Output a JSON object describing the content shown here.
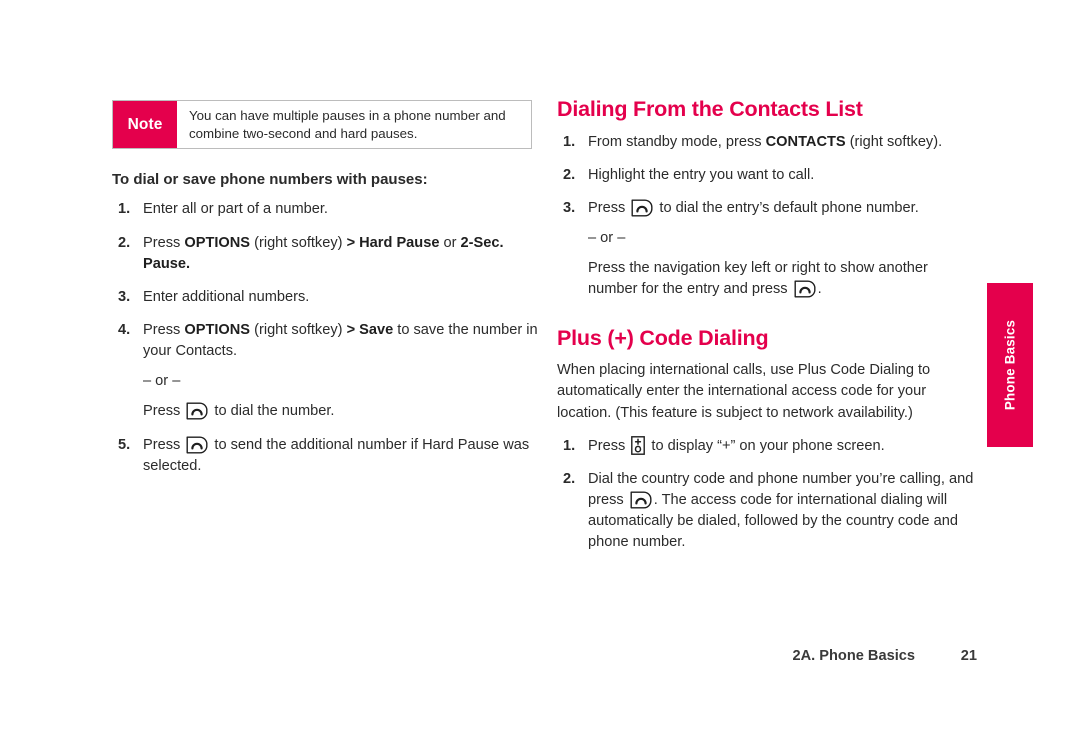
{
  "note": {
    "badge_label": "Note",
    "text": "You can have multiple pauses in a phone number and combine two-second and hard pauses.",
    "badge_color": "#e4004c",
    "border_color": "#bcbcbc"
  },
  "left_column": {
    "subheading": "To dial or save phone numbers with pauses:",
    "steps": [
      {
        "num": "1.",
        "parts": [
          {
            "type": "text",
            "value": "Enter all or part of a number."
          }
        ]
      },
      {
        "num": "2.",
        "parts": [
          {
            "type": "text",
            "value": "Press "
          },
          {
            "type": "bold",
            "value": "OPTIONS"
          },
          {
            "type": "text",
            "value": " (right softkey) "
          },
          {
            "type": "bold",
            "value": "> Hard Pause"
          },
          {
            "type": "text",
            "value": " or "
          },
          {
            "type": "bold",
            "value": "2-Sec. Pause."
          }
        ]
      },
      {
        "num": "3.",
        "parts": [
          {
            "type": "text",
            "value": "Enter additional numbers."
          }
        ]
      },
      {
        "num": "4.",
        "parts": [
          {
            "type": "text",
            "value": "Press "
          },
          {
            "type": "bold",
            "value": "OPTIONS"
          },
          {
            "type": "text",
            "value": " (right softkey) "
          },
          {
            "type": "bold",
            "value": "> Save"
          },
          {
            "type": "text",
            "value": " to save the number in your Contacts."
          }
        ],
        "sub_lines": [
          {
            "parts": [
              {
                "type": "text",
                "value": "– or –"
              }
            ]
          },
          {
            "parts": [
              {
                "type": "text",
                "value": "Press "
              },
              {
                "type": "icon",
                "value": "talk-key-icon"
              },
              {
                "type": "text",
                "value": " to dial the number."
              }
            ]
          }
        ]
      },
      {
        "num": "5.",
        "parts": [
          {
            "type": "text",
            "value": "Press "
          },
          {
            "type": "icon",
            "value": "talk-key-icon"
          },
          {
            "type": "text",
            "value": " to send the additional number if Hard Pause was selected."
          }
        ]
      }
    ]
  },
  "right_column": {
    "section_1": {
      "title": "Dialing From the Contacts List",
      "steps": [
        {
          "num": "1.",
          "parts": [
            {
              "type": "text",
              "value": "From standby mode, press "
            },
            {
              "type": "bold",
              "value": "CONTACTS"
            },
            {
              "type": "text",
              "value": " (right softkey)."
            }
          ]
        },
        {
          "num": "2.",
          "parts": [
            {
              "type": "text",
              "value": "Highlight the entry you want to call."
            }
          ]
        },
        {
          "num": "3.",
          "parts": [
            {
              "type": "text",
              "value": "Press "
            },
            {
              "type": "icon",
              "value": "talk-key-icon"
            },
            {
              "type": "text",
              "value": " to dial the entry’s default phone number."
            }
          ],
          "sub_lines": [
            {
              "parts": [
                {
                  "type": "text",
                  "value": "– or –"
                }
              ]
            },
            {
              "parts": [
                {
                  "type": "text",
                  "value": "Press the navigation key left or right to show another number for the entry and press "
                },
                {
                  "type": "icon",
                  "value": "talk-key-icon"
                },
                {
                  "type": "text",
                  "value": "."
                }
              ]
            }
          ]
        }
      ]
    },
    "section_2": {
      "title": "Plus (+) Code Dialing",
      "intro": "When placing international calls, use Plus Code Dialing to automatically enter the international access code for your location. (This feature is subject to network availability.)",
      "steps": [
        {
          "num": "1.",
          "parts": [
            {
              "type": "text",
              "value": "Press "
            },
            {
              "type": "icon",
              "value": "plus-zero-key-icon"
            },
            {
              "type": "text",
              "value": " to display “+” on your phone screen."
            }
          ]
        },
        {
          "num": "2.",
          "parts": [
            {
              "type": "text",
              "value": "Dial the country code and phone number you’re calling, and press "
            },
            {
              "type": "icon",
              "value": "talk-key-icon"
            },
            {
              "type": "text",
              "value": ". The access code for international dialing will automatically be dialed, followed by the country code and phone number."
            }
          ]
        }
      ]
    }
  },
  "side_tab": {
    "label": "Phone Basics",
    "color": "#e4004c"
  },
  "footer": {
    "chapter": "2A. Phone Basics",
    "page_number": "21"
  }
}
